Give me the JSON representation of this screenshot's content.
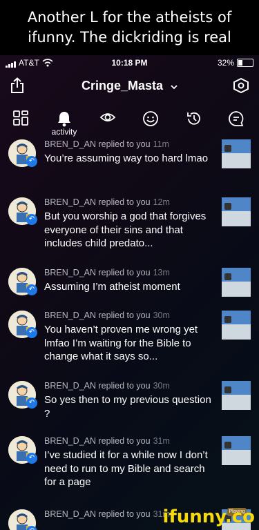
{
  "caption": {
    "line1": "Another L for the atheists of",
    "line2": "ifunny. The dickriding is real"
  },
  "status_bar": {
    "carrier": "AT&T",
    "time": "10:18 PM",
    "battery": "32%",
    "battery_level": 0.32
  },
  "header": {
    "title": "Cringe_Masta",
    "title_dropdown_icon": "chevron-down-icon",
    "left_icon": "share-icon",
    "right_icon": "settings-icon"
  },
  "tabs": [
    {
      "icon": "grid-icon"
    },
    {
      "icon": "bell-icon",
      "label": "activity",
      "active": true
    },
    {
      "icon": "eye-icon"
    },
    {
      "icon": "smiley-icon"
    },
    {
      "icon": "history-icon"
    },
    {
      "icon": "chat-icon"
    }
  ],
  "notifications": [
    {
      "user": "BREN_D_AN",
      "action": "replied to you",
      "ago": "11m",
      "message": "You’re assuming way too hard lmao"
    },
    {
      "user": "BREN_D_AN",
      "action": "replied to you",
      "ago": "12m",
      "message": "But you worship a god that forgives everyone of their sins and that includes child predato..."
    },
    {
      "user": "BREN_D_AN",
      "action": "replied to you",
      "ago": "13m",
      "message": "Assuming I’m atheist moment"
    },
    {
      "user": "BREN_D_AN",
      "action": "replied to you",
      "ago": "30m",
      "message": "You haven’t proven me wrong yet lmfao I’m waiting for the Bible to change what it says so..."
    },
    {
      "user": "BREN_D_AN",
      "action": "replied to you",
      "ago": "30m",
      "message": "So yes then to my previous question ?"
    },
    {
      "user": "BREN_D_AN",
      "action": "replied to you",
      "ago": "31m",
      "message": "I’ve studied it for a while now I don’t need to run to my Bible and search for a page"
    },
    {
      "user": "BREN_D_AN",
      "action": "replied to you",
      "ago": "31m",
      "message": ""
    }
  ],
  "watermark": "ifunny.co",
  "playing_badge": "Playing",
  "colors": {
    "accent": "#1e78e6",
    "watermark": "#f5d90a",
    "background": "#000000"
  }
}
